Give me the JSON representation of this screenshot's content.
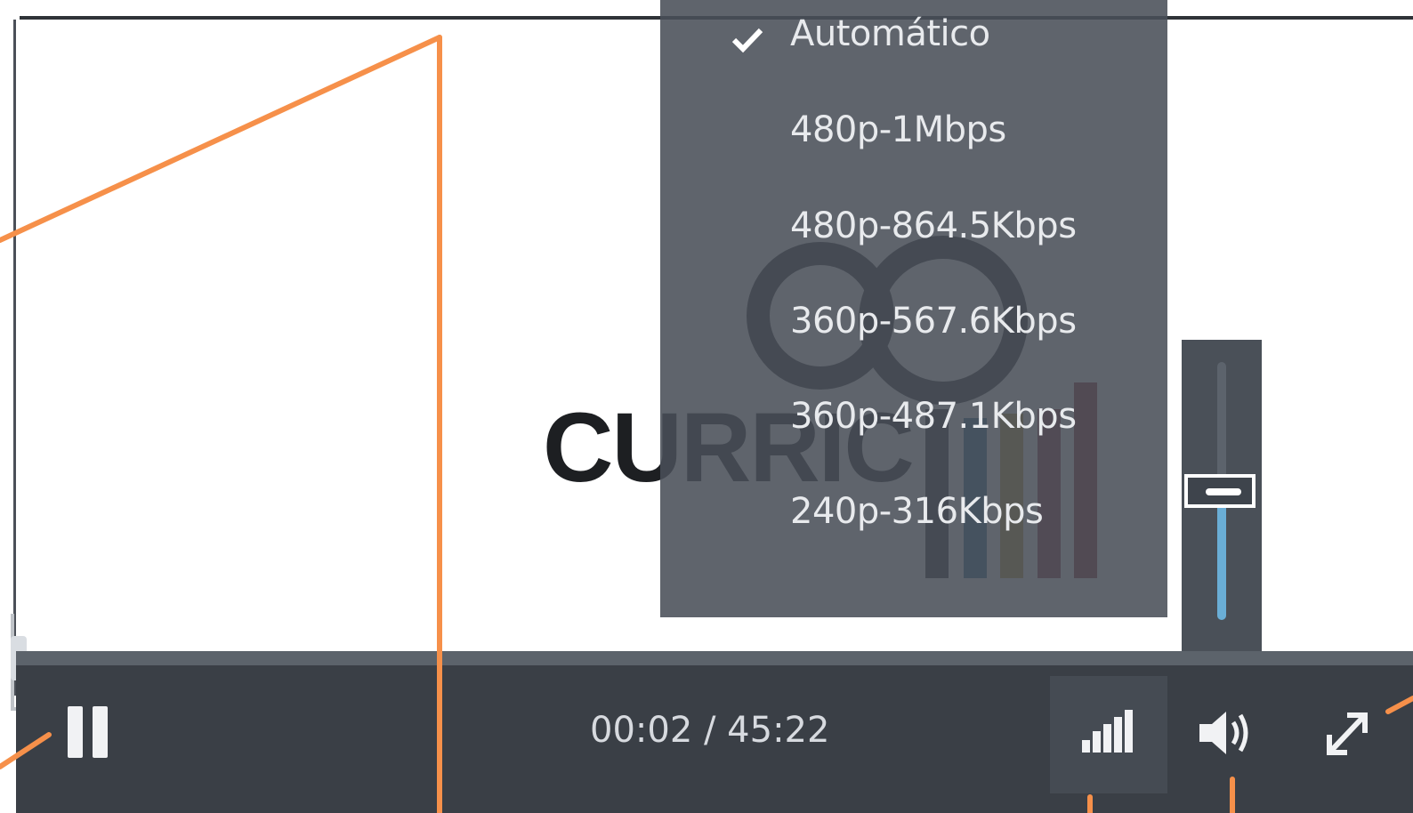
{
  "video": {
    "logo_text": "CURRIC"
  },
  "quality_menu": {
    "items": [
      {
        "label": "Automático",
        "selected": true
      },
      {
        "label": "480p-1Mbps",
        "selected": false
      },
      {
        "label": "480p-864.5Kbps",
        "selected": false
      },
      {
        "label": "360p-567.6Kbps",
        "selected": false
      },
      {
        "label": "360p-487.1Kbps",
        "selected": false
      },
      {
        "label": "240p-316Kbps",
        "selected": false
      }
    ]
  },
  "volume": {
    "level": 0.55
  },
  "controls": {
    "time": "00:02 / 45:22",
    "icons": [
      "pause-icon",
      "signal-bars-icon",
      "speaker-icon",
      "fullscreen-icon",
      "check-icon"
    ]
  },
  "colors": {
    "annotation": "#f6904a",
    "control_bar": "#3a3f46",
    "menu_bg": "#494f58",
    "volume_fill": "#6aaed6",
    "logo_bars": [
      "#2a2e33",
      "#2f6f95",
      "#b99a3c",
      "#8a3146",
      "#8d2b36"
    ]
  }
}
